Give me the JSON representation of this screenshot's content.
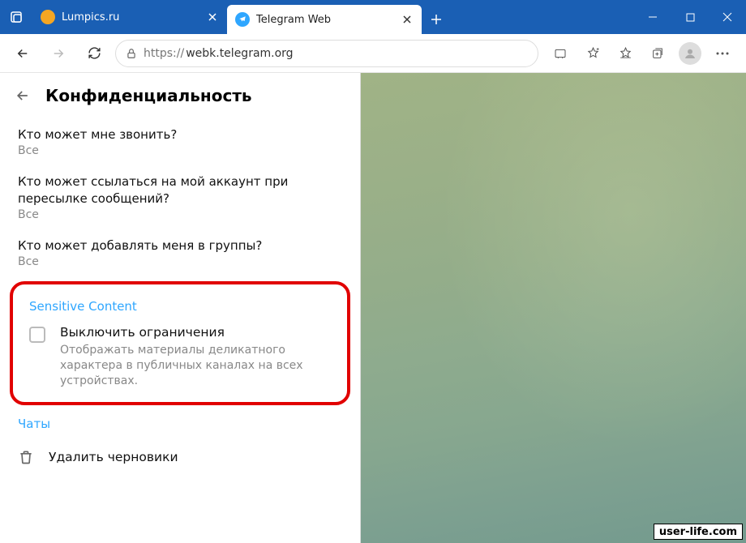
{
  "browser": {
    "tabs": [
      {
        "label": "Lumpics.ru",
        "active": false
      },
      {
        "label": "Telegram Web",
        "active": true
      }
    ],
    "url_prefix": "https://",
    "url_host": "webk.telegram.org"
  },
  "panel": {
    "title": "Конфиденциальность",
    "privacy": [
      {
        "q": "Кто может мне звонить?",
        "a": "Все"
      },
      {
        "q": "Кто может ссылаться на мой аккаунт при пересылке сообщений?",
        "a": "Все"
      },
      {
        "q": "Кто может добавлять меня в группы?",
        "a": "Все"
      }
    ],
    "sensitive": {
      "title": "Sensitive Content",
      "toggle": "Выключить ограничения",
      "desc": "Отображать материалы деликатного характера в публичных каналах на всех устройствах."
    },
    "chats": {
      "title": "Чаты",
      "delete_drafts": "Удалить черновики"
    }
  },
  "watermark": "user-life.com"
}
